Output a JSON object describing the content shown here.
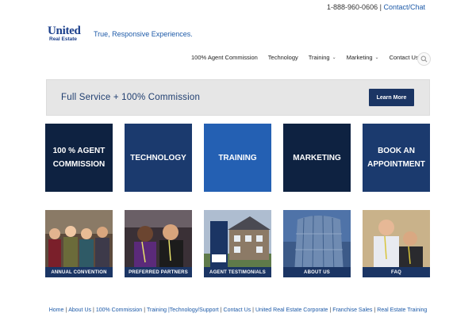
{
  "topbar": {
    "phone": "1-888-960-0606",
    "separator": "|",
    "contact": "Contact/Chat"
  },
  "logo": {
    "word": "United",
    "sub": "Real Estate"
  },
  "tagline": "True, Responsive Experiences.",
  "nav": {
    "items": [
      {
        "label": "100% Agent Commission",
        "has_dropdown": false
      },
      {
        "label": "Technology",
        "has_dropdown": false
      },
      {
        "label": "Training",
        "has_dropdown": true
      },
      {
        "label": "Marketing",
        "has_dropdown": true
      },
      {
        "label": "Contact Us",
        "has_dropdown": false
      }
    ],
    "search_icon": "search-icon"
  },
  "banner": {
    "text": "Full Service + 100% Commission",
    "button": "Learn More"
  },
  "tiles": [
    {
      "line1": "100 % AGENT",
      "line2": "COMMISSION",
      "color": "#0e2241"
    },
    {
      "line1": "TECHNOLOGY",
      "line2": "",
      "color": "#1b3a6e"
    },
    {
      "line1": "TRAINING",
      "line2": "",
      "color": "#2460b3"
    },
    {
      "line1": "MARKETING",
      "line2": "",
      "color": "#0e2241"
    },
    {
      "line1": "BOOK AN",
      "line2": "APPOINTMENT",
      "color": "#1b3a6e"
    }
  ],
  "photos": [
    {
      "label": "ANNUAL CONVENTION"
    },
    {
      "label": "PREFERRED PARTNERS"
    },
    {
      "label": "AGENT TESTIMONIALS"
    },
    {
      "label": "ABOUT US"
    },
    {
      "label": "FAQ"
    }
  ],
  "footer": {
    "links": [
      "Home",
      "About Us",
      "100% Commission",
      "Training |Technology/Support",
      "Contact Us",
      "United Real Estate Corporate",
      "Franchise Sales",
      "Real Estate Training"
    ],
    "separator": "|"
  },
  "colors": {
    "navy": "#1b3564",
    "link": "#1d5aa8",
    "banner_bg": "#e6e6e6"
  }
}
